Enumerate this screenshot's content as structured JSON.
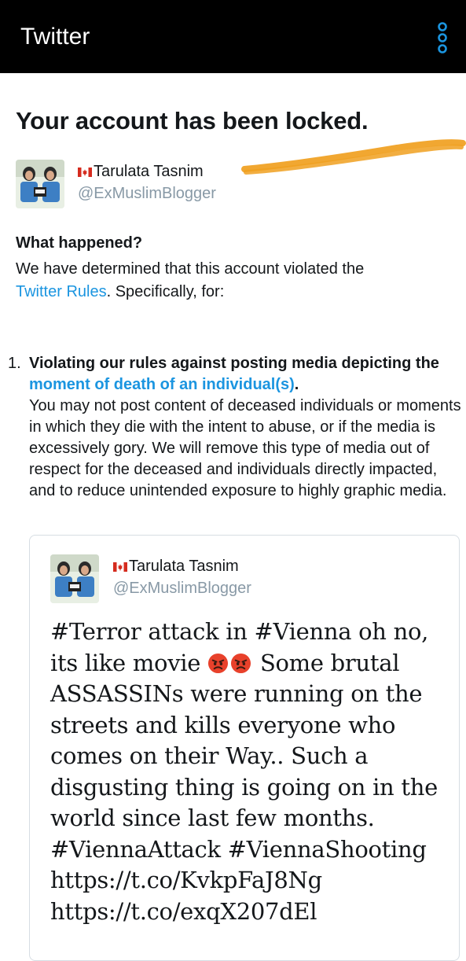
{
  "appbar": {
    "title": "Twitter",
    "menu_icon": "overflow-menu-icon"
  },
  "headline": "Your account has been locked.",
  "account": {
    "name": "Tarulata Tasnim",
    "handle": "@ExMuslimBlogger",
    "flag_icon": "canada-flag-icon"
  },
  "what_happened": {
    "label": "What happened?",
    "body_pre": "We have determined that this account violated the ",
    "rules_link": "Twitter Rules",
    "body_post": ". Specifically, for:"
  },
  "violation": {
    "number": "1.",
    "title_pre": "Violating our rules against posting media depicting the ",
    "title_link": "moment of death of an individual(s)",
    "title_post": ".",
    "body": "You may not post content of deceased individuals or moments in which they die with the intent to abuse, or if the media is excessively gory. We will remove this type of media out of respect for the deceased and individuals directly impacted, and to reduce unintended exposure to highly graphic media."
  },
  "tweet": {
    "name": "Tarulata Tasnim",
    "handle": "@ExMuslimBlogger",
    "lines": {
      "l1": "#Terror attack in #Vienna oh no,",
      "l2a": "its like movie ",
      "l2b": " Some brutal",
      "l3": "ASSASSINs were running on the",
      "l4": "streets and kills everyone who",
      "l5": "comes on their Way.. Such a",
      "l6": "disgusting thing is going on in the",
      "l7": "world since last few months.",
      "l8": "#ViennaAttack #ViennaShooting",
      "l9": "https://t.co/KvkpFaJ8Ng",
      "l10": "https://t.co/exqX207dEl"
    },
    "emoji_icon": "angry-face-icon"
  },
  "colors": {
    "link": "#1b95e0",
    "handle": "#8899a6",
    "accent_orange": "#f0a020",
    "appbar": "#000000"
  }
}
